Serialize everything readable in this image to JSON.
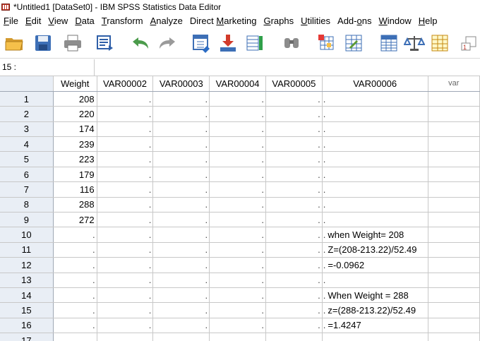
{
  "window": {
    "title": "*Untitled1 [DataSet0] - IBM SPSS Statistics Data Editor"
  },
  "menu": [
    {
      "label": "File",
      "ul": "F",
      "rest": "ile"
    },
    {
      "label": "Edit",
      "ul": "E",
      "rest": "dit"
    },
    {
      "label": "View",
      "ul": "V",
      "rest": "iew"
    },
    {
      "label": "Data",
      "ul": "D",
      "rest": "ata"
    },
    {
      "label": "Transform",
      "ul": "T",
      "rest": "ransform"
    },
    {
      "label": "Analyze",
      "ul": "A",
      "rest": "nalyze"
    },
    {
      "label": "Direct Marketing",
      "pre": "Direct ",
      "ul": "M",
      "rest": "arketing"
    },
    {
      "label": "Graphs",
      "ul": "G",
      "rest": "raphs"
    },
    {
      "label": "Utilities",
      "ul": "U",
      "rest": "tilities"
    },
    {
      "label": "Add-ons",
      "pre": "Add-",
      "ul": "o",
      "rest": "ns"
    },
    {
      "label": "Window",
      "ul": "W",
      "rest": "indow"
    },
    {
      "label": "Help",
      "ul": "H",
      "rest": "elp"
    }
  ],
  "toolbar": [
    {
      "name": "open-icon"
    },
    {
      "name": "save-icon"
    },
    {
      "name": "print-icon"
    },
    {
      "name": "dialog-recall-icon"
    },
    {
      "name": "undo-icon"
    },
    {
      "name": "redo-icon"
    },
    {
      "name": "goto-case-icon"
    },
    {
      "name": "goto-variable-icon"
    },
    {
      "name": "variables-icon"
    },
    {
      "name": "find-icon"
    },
    {
      "name": "insert-cases-icon"
    },
    {
      "name": "insert-variable-icon"
    },
    {
      "name": "split-file-icon"
    },
    {
      "name": "weight-cases-icon"
    },
    {
      "name": "select-cases-icon"
    },
    {
      "name": "value-labels-icon"
    }
  ],
  "cell_editor": {
    "reference": "15 :",
    "value": ""
  },
  "grid": {
    "columns": [
      "Weight",
      "VAR00002",
      "VAR00003",
      "VAR00004",
      "VAR00005",
      "VAR00006",
      "var"
    ],
    "missing_symbol": ".",
    "rows": [
      {
        "n": "1",
        "weight": "208",
        "var6": ""
      },
      {
        "n": "2",
        "weight": "220",
        "var6": ""
      },
      {
        "n": "3",
        "weight": "174",
        "var6": ""
      },
      {
        "n": "4",
        "weight": "239",
        "var6": ""
      },
      {
        "n": "5",
        "weight": "223",
        "var6": ""
      },
      {
        "n": "6",
        "weight": "179",
        "var6": ""
      },
      {
        "n": "7",
        "weight": "116",
        "var6": ""
      },
      {
        "n": "8",
        "weight": "288",
        "var6": ""
      },
      {
        "n": "9",
        "weight": "272",
        "var6": ""
      },
      {
        "n": "10",
        "weight": ".",
        "var6": "when Weight= 208"
      },
      {
        "n": "11",
        "weight": ".",
        "var6": "Z=(208-213.22)/52.49"
      },
      {
        "n": "12",
        "weight": ".",
        "var6": "=-0.0962"
      },
      {
        "n": "13",
        "weight": ".",
        "var6": ""
      },
      {
        "n": "14",
        "weight": ".",
        "var6": "When Weight = 288"
      },
      {
        "n": "15",
        "weight": ".",
        "var6": "z=(288-213.22)/52.49"
      },
      {
        "n": "16",
        "weight": ".",
        "var6": "=1.4247"
      },
      {
        "n": "17",
        "weight": "",
        "var6": ""
      }
    ]
  }
}
